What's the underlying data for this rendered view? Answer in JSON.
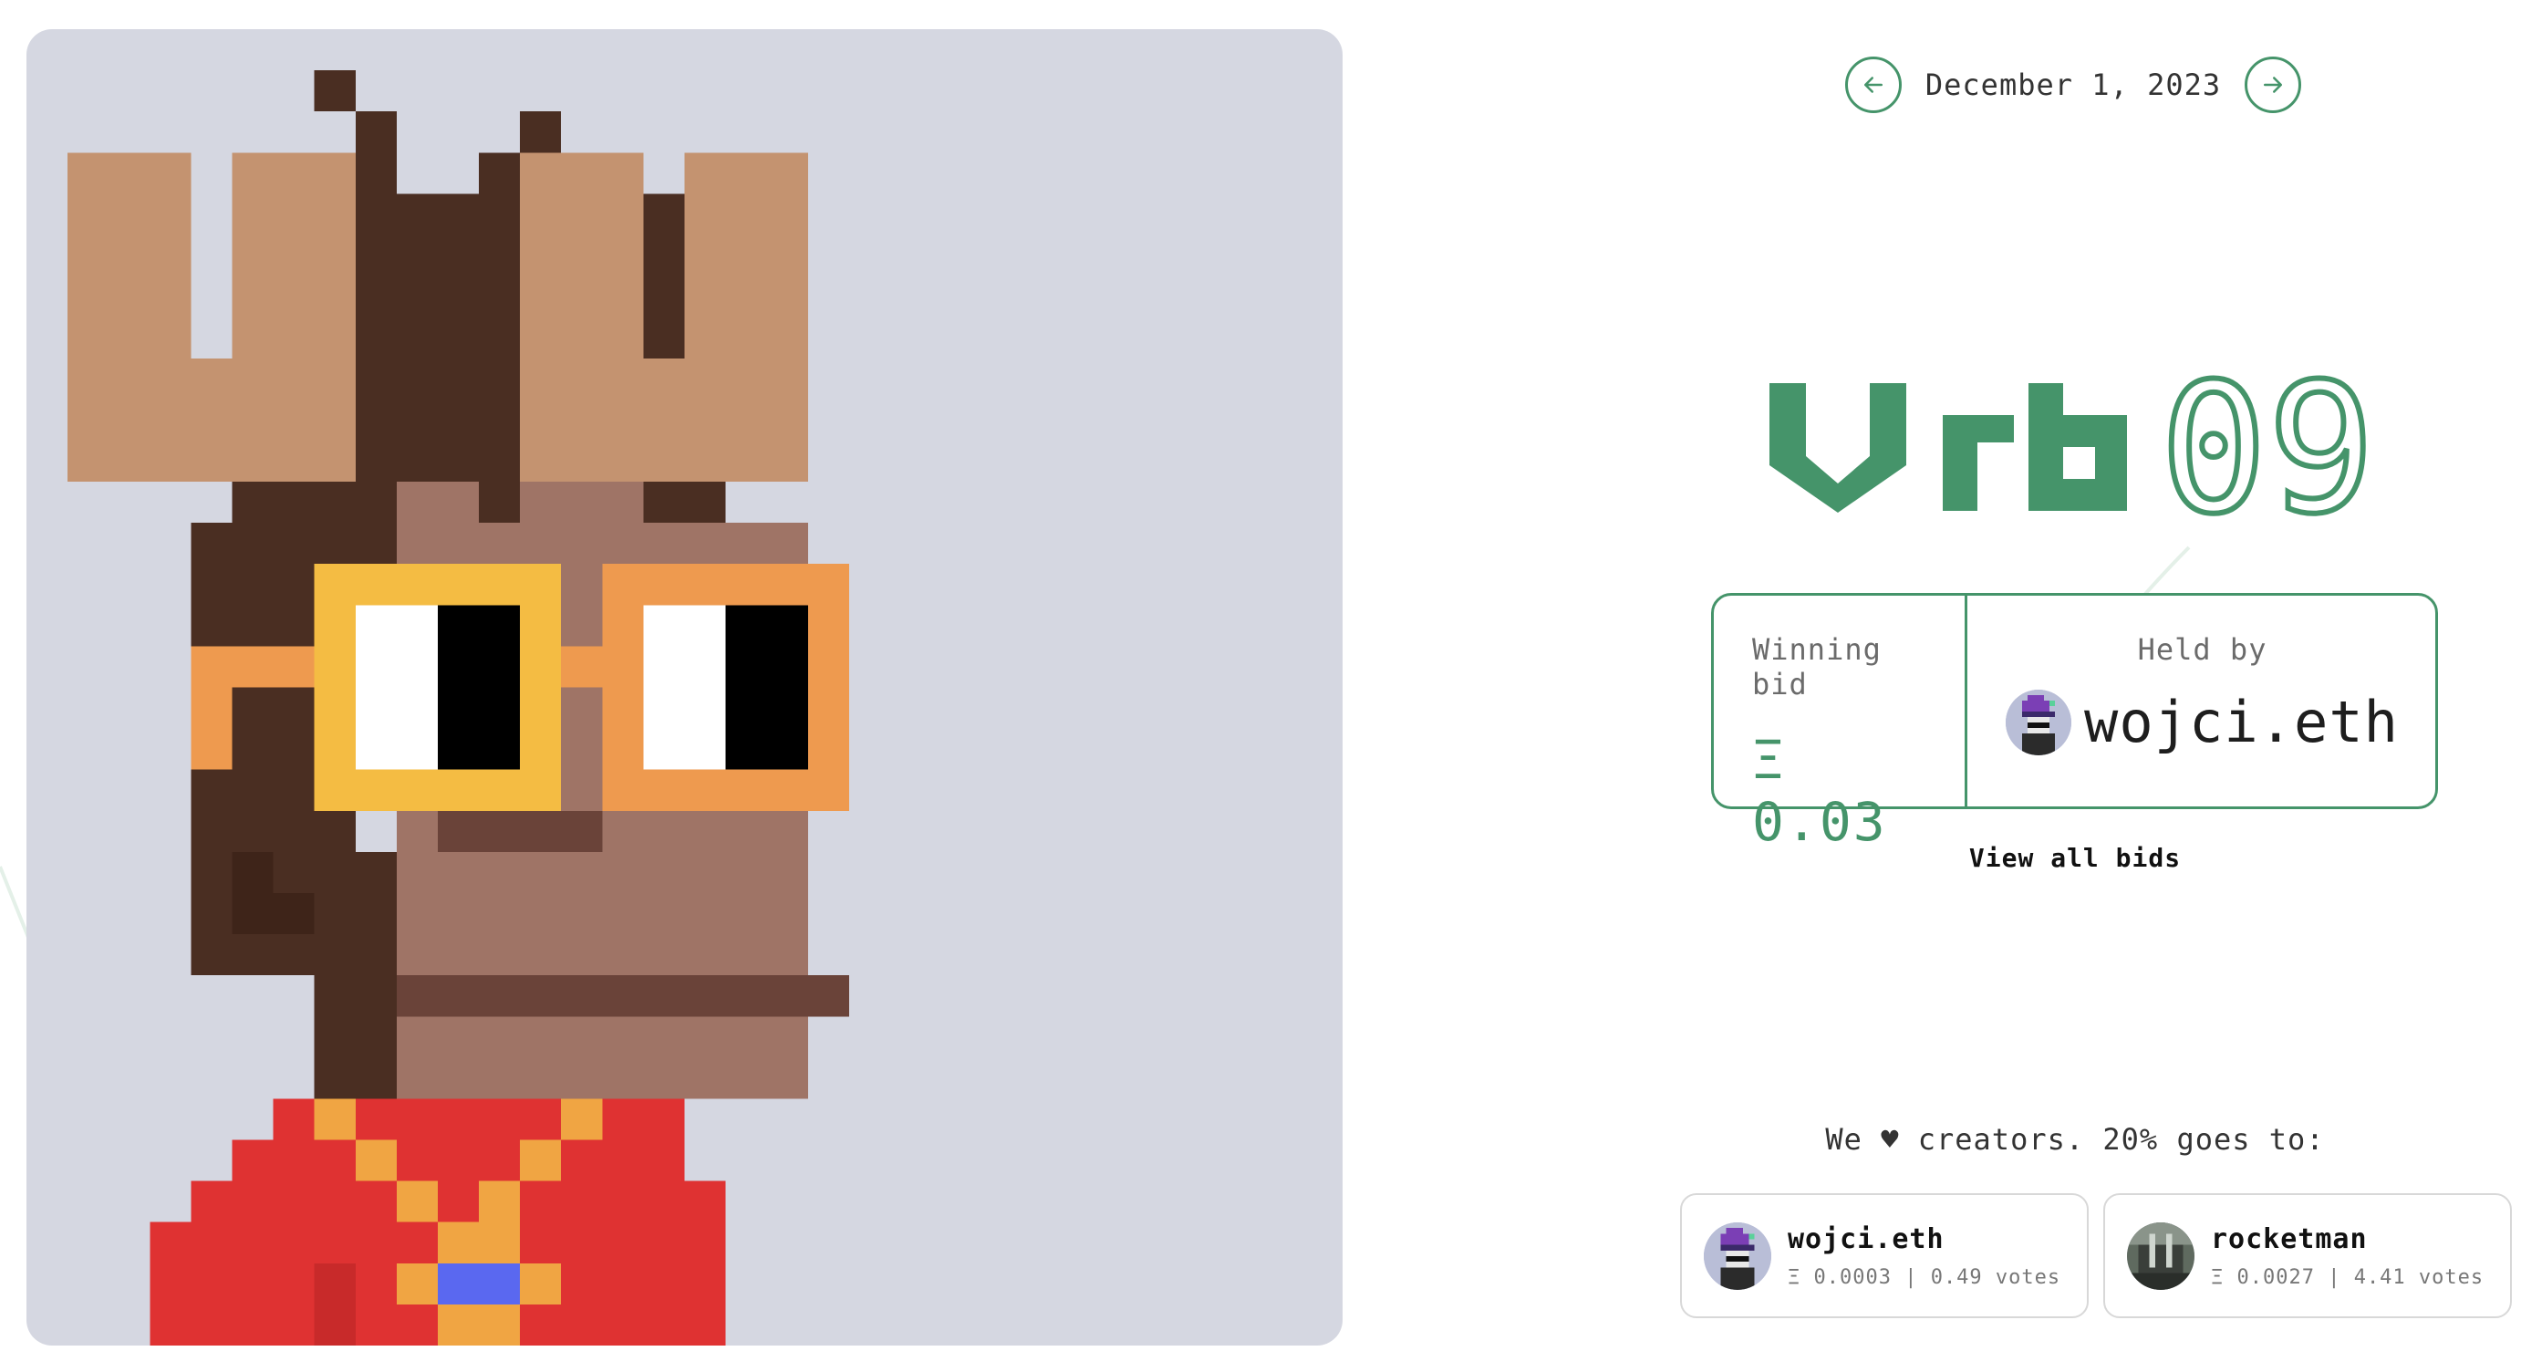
{
  "navigation": {
    "date": "December 1, 2023",
    "prev_icon": "arrow-left-icon",
    "next_icon": "arrow-right-icon"
  },
  "auction": {
    "title_word": "Vrb",
    "title_number": "09",
    "winning_bid_label": "Winning bid",
    "winning_bid_value": "Ξ 0.03",
    "held_by_label": "Held by",
    "holder": "wojci.eth",
    "view_all_bids": "View all bids"
  },
  "creators": {
    "heading_prefix": "We",
    "heart_icon": "♥",
    "heading_suffix": "creators. 20% goes to:",
    "items": [
      {
        "name": "wojci.eth",
        "stats": "Ξ 0.0003 | 0.49 votes"
      },
      {
        "name": "rocketman",
        "stats": "Ξ 0.0027 | 4.41 votes"
      }
    ]
  },
  "colors": {
    "accent": "#45946a",
    "art_background": "#d5d7e1",
    "fur": "#4a2e22",
    "antler": "#c49370",
    "face": "#9f7466",
    "glasses_left": "#f4bc43",
    "glasses_right": "#ee9a4f",
    "shirt": "#df3232"
  }
}
